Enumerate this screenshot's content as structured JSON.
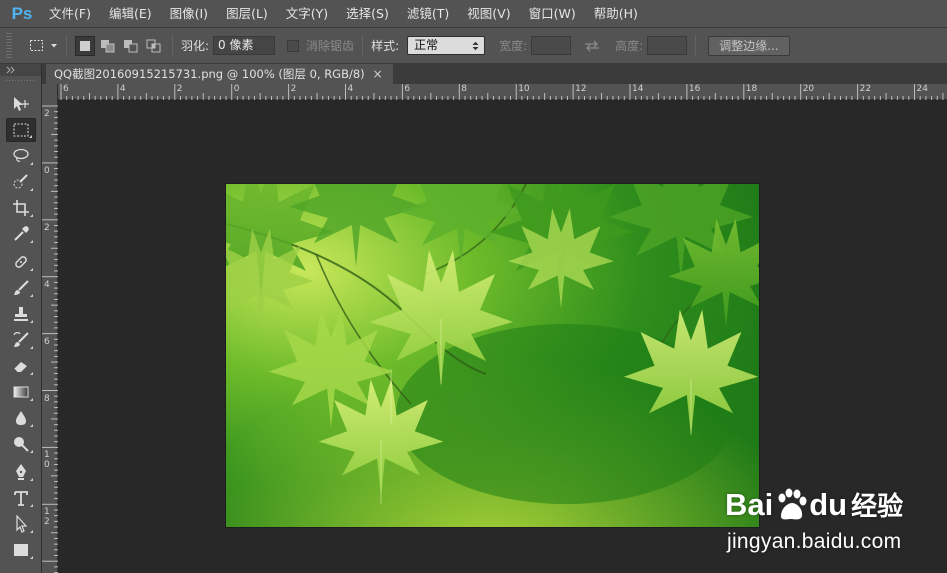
{
  "app": {
    "logo": "Ps"
  },
  "menu": [
    {
      "label": "文件(F)"
    },
    {
      "label": "编辑(E)"
    },
    {
      "label": "图像(I)"
    },
    {
      "label": "图层(L)"
    },
    {
      "label": "文字(Y)"
    },
    {
      "label": "选择(S)"
    },
    {
      "label": "滤镜(T)"
    },
    {
      "label": "视图(V)"
    },
    {
      "label": "窗口(W)"
    },
    {
      "label": "帮助(H)"
    }
  ],
  "options": {
    "feather_label": "羽化:",
    "feather_value": "0 像素",
    "antialias_label": "消除锯齿",
    "style_label": "样式:",
    "style_value": "正常",
    "width_label": "宽度:",
    "height_label": "高度:",
    "refine_button": "调整边缘..."
  },
  "document": {
    "tab_title": "QQ截图20160915215731.png @ 100% (图层 0, RGB/8)",
    "close_glyph": "×"
  },
  "ruler": {
    "h_labels": [
      "6",
      "4",
      "2",
      "0",
      "2",
      "4",
      "6",
      "8",
      "10",
      "12",
      "14",
      "16",
      "18",
      "20",
      "22",
      "24"
    ],
    "v_labels": [
      "2",
      "0",
      "2",
      "4",
      "6",
      "8",
      "1 0",
      "1 2"
    ]
  },
  "tools": [
    {
      "name": "move-tool-icon",
      "active": false
    },
    {
      "name": "marquee-tool-icon",
      "active": true
    },
    {
      "name": "lasso-tool-icon",
      "active": false
    },
    {
      "name": "quick-selection-tool-icon",
      "active": false
    },
    {
      "name": "crop-tool-icon",
      "active": false
    },
    {
      "name": "eyedropper-tool-icon",
      "active": false
    },
    {
      "name": "healing-brush-tool-icon",
      "active": false
    },
    {
      "name": "brush-tool-icon",
      "active": false
    },
    {
      "name": "clone-stamp-tool-icon",
      "active": false
    },
    {
      "name": "history-brush-tool-icon",
      "active": false
    },
    {
      "name": "eraser-tool-icon",
      "active": false
    },
    {
      "name": "gradient-tool-icon",
      "active": false
    },
    {
      "name": "blur-tool-icon",
      "active": false
    },
    {
      "name": "dodge-tool-icon",
      "active": false
    },
    {
      "name": "pen-tool-icon",
      "active": false
    },
    {
      "name": "type-tool-icon",
      "active": false
    },
    {
      "name": "path-selection-tool-icon",
      "active": false
    },
    {
      "name": "rectangle-tool-icon",
      "active": false
    }
  ],
  "watermark": {
    "brand_left": "Bai",
    "brand_mid": "du",
    "brand_cn": "经验",
    "url": "jingyan.baidu.com"
  },
  "colors": {
    "ui_bg": "#535353",
    "canvas_bg": "#282828",
    "ps_blue": "#4fb4f0"
  }
}
